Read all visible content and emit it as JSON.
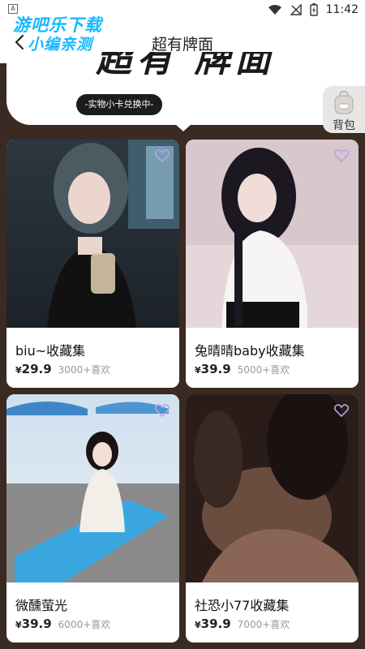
{
  "watermark": {
    "line1": "游吧乐下载",
    "line2": "小编亲测"
  },
  "status": {
    "time": "11:42",
    "app_indicator": "A"
  },
  "header": {
    "title": "超有牌面"
  },
  "banner": {
    "heading": "超有 牌面",
    "pill": "-实物小卡兑换中-"
  },
  "backpack": {
    "label": "背包"
  },
  "cards": [
    {
      "title": "biu~收藏集",
      "currency": "¥",
      "price": "29.9",
      "likes": "3000+喜欢"
    },
    {
      "title": "兔晴晴baby收藏集",
      "currency": "¥",
      "price": "39.9",
      "likes": "5000+喜欢"
    },
    {
      "title": "微醺萤光",
      "currency": "¥",
      "price": "39.9",
      "likes": "6000+喜欢"
    },
    {
      "title": "社恐小77收藏集",
      "currency": "¥",
      "price": "39.9",
      "likes": "7000+喜欢"
    }
  ],
  "colors": {
    "page_bg": "#3b2a22",
    "card_bg": "#ffffff",
    "accent_watermark": "#19b7ff"
  },
  "icons": [
    "wifi-icon",
    "signal-icon",
    "battery-icon",
    "back-arrow-icon",
    "backpack-icon",
    "heart-icon"
  ]
}
